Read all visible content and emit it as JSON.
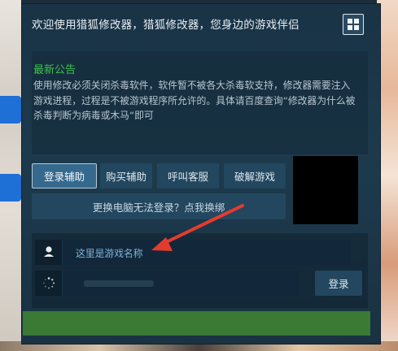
{
  "window": {
    "title": "欢迎使用猎狐修改器，猎狐修改器，您身边的游戏伴侣",
    "menu_icon": "grid-icon"
  },
  "notice": {
    "title": "最新公告",
    "body": "使用修改必须关闭杀毒软件，软件暂不被各大杀毒软支持，修改器需要注入游戏进程，过程是不被游戏程序所允许的。具体请百度查询“修改器为什么被杀毒判断为病毒或木马“即可"
  },
  "actions": {
    "login_assist": "登录辅助",
    "buy_assist": "购买辅助",
    "call_support": "呼叫客服",
    "crack_game": "破解游戏",
    "rebind": "更换电脑无法登录？点我换绑"
  },
  "login": {
    "game_name": "这里是游戏名称",
    "user_icon": "user-icon",
    "loading_icon": "spinner-icon",
    "login_label": "登录"
  },
  "colors": {
    "accent_green": "#3fbf4f",
    "status_green": "#3a7a35",
    "annotation_red": "#e53b2f"
  }
}
